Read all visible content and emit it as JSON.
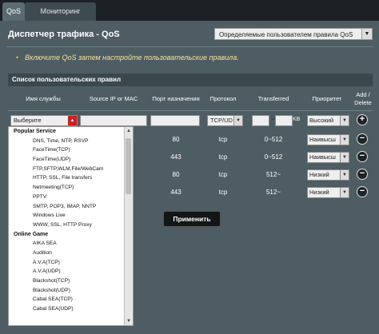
{
  "tabs": [
    {
      "label": "QoS"
    },
    {
      "label": "Мониторинг трафика"
    }
  ],
  "page": {
    "title": "Диспетчер трафика - QoS",
    "mode_select": "Определяемые пользователем правила QoS",
    "hint": "Включите QoS затем настройте пользовательские правила."
  },
  "rules_table": {
    "header": "Список пользовательских правил",
    "columns": [
      "Имя службы",
      "Source IP or MAC",
      "Порт назначения",
      "Протокол",
      "Transferred",
      "Приоритет",
      "Add / Delete"
    ],
    "input_row": {
      "service_select": "Выберите",
      "protocol": "TCP/UD",
      "transfer_sep": "~",
      "transfer_unit": "KB",
      "priority": "Высокий",
      "add_icon": "+"
    },
    "rows": [
      {
        "port": "80",
        "protocol": "tcp",
        "transferred": "0~512",
        "priority": "Наивысш",
        "delete_icon": "−"
      },
      {
        "port": "443",
        "protocol": "tcp",
        "transferred": "0~512",
        "priority": "Наивысш",
        "delete_icon": "−"
      },
      {
        "port": "80",
        "protocol": "tcp",
        "transferred": "512~",
        "priority": "Низкий",
        "delete_icon": "−"
      },
      {
        "port": "443",
        "protocol": "tcp",
        "transferred": "512~",
        "priority": "Низкий",
        "delete_icon": "−"
      }
    ]
  },
  "apply_button": "Применить",
  "service_dropdown": {
    "groups": [
      {
        "name": "Popular Service",
        "items": [
          "DNS, Time, NTP, RSVP",
          "FaceTime(TCP)",
          "FaceTime(UDP)",
          "FTP,SFTP,WLM,File/WebCam",
          "HTTP, SSL, File transfers",
          "Netmeeting(TCP)",
          "PPTV",
          "SMTP, POP3, IMAP, NNTP",
          "Windows Live",
          "WWW, SSL, HTTP Proxy"
        ]
      },
      {
        "name": "Online Game",
        "items": [
          "AIKA SEA",
          "Audition",
          "A.V.A(TCP)",
          "A.V.A(UDP)",
          "Blackshot(TCP)",
          "Blackshot(UDP)",
          "Cabal SEA(TCP)",
          "Cabal SEA(UDP)"
        ]
      }
    ]
  },
  "colors": {
    "panel": "#4e5d63",
    "background": "#202628",
    "hint_text": "#f5e19a",
    "accent_red": "#cc2020"
  }
}
